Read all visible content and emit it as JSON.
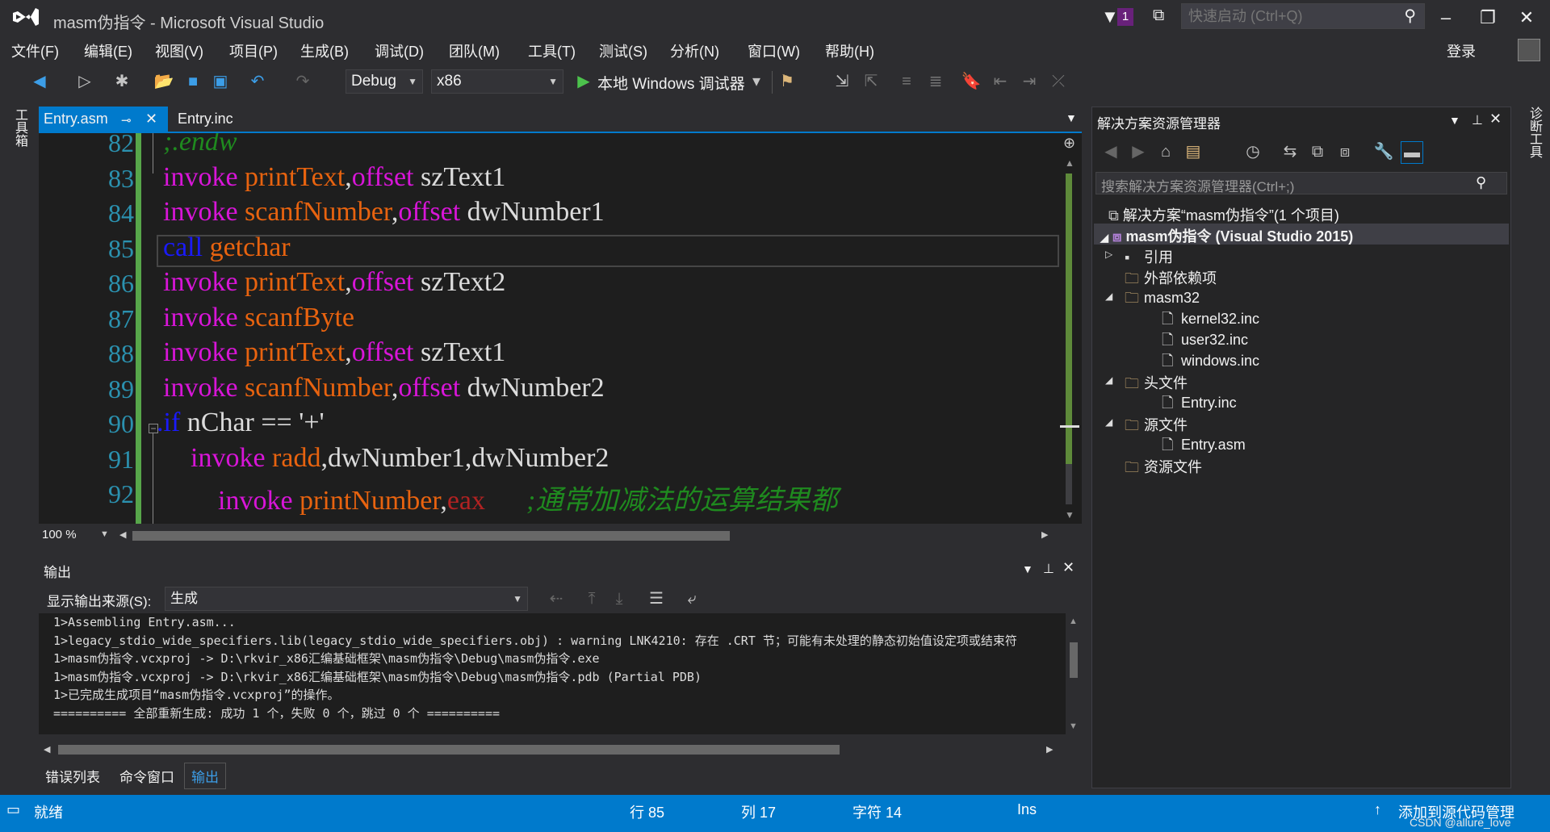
{
  "window": {
    "title": "masm伪指令 - Microsoft Visual Studio",
    "notification_count": "1",
    "quick_launch_placeholder": "快速启动 (Ctrl+Q)",
    "login_label": "登录"
  },
  "menu": [
    "文件(F)",
    "编辑(E)",
    "视图(V)",
    "项目(P)",
    "生成(B)",
    "调试(D)",
    "团队(M)",
    "工具(T)",
    "测试(S)",
    "分析(N)",
    "窗口(W)",
    "帮助(H)"
  ],
  "toolbar": {
    "config": "Debug",
    "platform": "x86",
    "debugger_label": "本地 Windows 调试器"
  },
  "left_strip_label": "工具箱",
  "right_strip_label": "诊断工具",
  "tabs": {
    "active": "Entry.asm",
    "inactive": "Entry.inc"
  },
  "editor": {
    "zoom": "100 %",
    "lines": [
      {
        "no": "82",
        "segs": [
          {
            "t": ";.endw",
            "c": "kw-green"
          }
        ]
      },
      {
        "no": "83",
        "segs": [
          {
            "t": "invoke ",
            "c": "kw-pink"
          },
          {
            "t": "printText",
            "c": "kw-orange"
          },
          {
            "t": ",",
            "c": ""
          },
          {
            "t": "offset ",
            "c": "kw-pink"
          },
          {
            "t": "szText1",
            "c": ""
          }
        ]
      },
      {
        "no": "84",
        "segs": [
          {
            "t": "invoke ",
            "c": "kw-pink"
          },
          {
            "t": "scanfNumber",
            "c": "kw-orange"
          },
          {
            "t": ",",
            "c": ""
          },
          {
            "t": "offset ",
            "c": "kw-pink"
          },
          {
            "t": "dwNumber1",
            "c": ""
          }
        ]
      },
      {
        "no": "85",
        "segs": [
          {
            "t": "call ",
            "c": "kw-blue"
          },
          {
            "t": "getchar",
            "c": "kw-orange"
          }
        ]
      },
      {
        "no": "86",
        "segs": [
          {
            "t": "invoke ",
            "c": "kw-pink"
          },
          {
            "t": "printText",
            "c": "kw-orange"
          },
          {
            "t": ",",
            "c": ""
          },
          {
            "t": "offset ",
            "c": "kw-pink"
          },
          {
            "t": "szText2",
            "c": ""
          }
        ]
      },
      {
        "no": "87",
        "segs": [
          {
            "t": "invoke ",
            "c": "kw-pink"
          },
          {
            "t": "scanfByte",
            "c": "kw-orange"
          }
        ]
      },
      {
        "no": "88",
        "segs": [
          {
            "t": "invoke ",
            "c": "kw-pink"
          },
          {
            "t": "printText",
            "c": "kw-orange"
          },
          {
            "t": ",",
            "c": ""
          },
          {
            "t": "offset ",
            "c": "kw-pink"
          },
          {
            "t": "szText1",
            "c": ""
          }
        ]
      },
      {
        "no": "89",
        "segs": [
          {
            "t": "invoke ",
            "c": "kw-pink"
          },
          {
            "t": "scanfNumber",
            "c": "kw-orange"
          },
          {
            "t": ",",
            "c": ""
          },
          {
            "t": "offset ",
            "c": "kw-pink"
          },
          {
            "t": "dwNumber2",
            "c": ""
          }
        ]
      },
      {
        "no": "90",
        "segs": [
          {
            "t": ".if ",
            "c": "kw-blue"
          },
          {
            "t": "nChar == '+'",
            "c": ""
          }
        ]
      },
      {
        "no": "91",
        "segs": [
          {
            "t": "    invoke ",
            "c": "kw-pink"
          },
          {
            "t": "radd",
            "c": "kw-orange"
          },
          {
            "t": ",dwNumber1,dwNumber2",
            "c": ""
          }
        ]
      },
      {
        "no": "92",
        "segs": [
          {
            "t": "        invoke ",
            "c": "kw-pink"
          },
          {
            "t": "printNumber",
            "c": "kw-orange"
          },
          {
            "t": ",",
            "c": ""
          },
          {
            "t": "eax",
            "c": "kw-red"
          },
          {
            "t": "      ;通常加减法的运算结果都",
            "c": "kw-green"
          }
        ]
      }
    ]
  },
  "output": {
    "title": "输出",
    "source_label": "显示输出来源(S):",
    "source_value": "生成",
    "lines": [
      "1>Assembling Entry.asm...",
      "1>legacy_stdio_wide_specifiers.lib(legacy_stdio_wide_specifiers.obj) : warning LNK4210: 存在 .CRT 节；可能有未处理的静态初始值设定项或结束符",
      "1>masm伪指令.vcxproj -> D:\\rkvir_x86汇编基础框架\\masm伪指令\\Debug\\masm伪指令.exe",
      "1>masm伪指令.vcxproj -> D:\\rkvir_x86汇编基础框架\\masm伪指令\\Debug\\masm伪指令.pdb (Partial PDB)",
      "1>已完成生成项目“masm伪指令.vcxproj”的操作。",
      "========== 全部重新生成: 成功 1 个，失败 0 个，跳过 0 个 =========="
    ]
  },
  "bottom_tabs": [
    "错误列表",
    "命令窗口",
    "输出"
  ],
  "solution_explorer": {
    "title": "解决方案资源管理器",
    "search_placeholder": "搜索解决方案资源管理器(Ctrl+;)",
    "solution": "解决方案“masm伪指令”(1 个项目)",
    "project": "masm伪指令 (Visual Studio 2015)",
    "items": [
      {
        "label": "引用",
        "indent": 1,
        "icon": "references-icon"
      },
      {
        "label": "外部依赖项",
        "indent": 1,
        "icon": "folder-icon"
      },
      {
        "label": "masm32",
        "indent": 1,
        "icon": "folder-icon"
      },
      {
        "label": "kernel32.inc",
        "indent": 2,
        "icon": "file-icon"
      },
      {
        "label": "user32.inc",
        "indent": 2,
        "icon": "file-icon"
      },
      {
        "label": "windows.inc",
        "indent": 2,
        "icon": "file-icon"
      },
      {
        "label": "头文件",
        "indent": 1,
        "icon": "folder-icon"
      },
      {
        "label": "Entry.inc",
        "indent": 2,
        "icon": "file-icon"
      },
      {
        "label": "源文件",
        "indent": 1,
        "icon": "folder-icon"
      },
      {
        "label": "Entry.asm",
        "indent": 2,
        "icon": "file-icon"
      },
      {
        "label": "资源文件",
        "indent": 1,
        "icon": "folder-icon"
      }
    ]
  },
  "status_bar": {
    "ready": "就绪",
    "line": "行 85",
    "col": "列 17",
    "char": "字符 14",
    "mode": "Ins",
    "source_control": "添加到源代码管理",
    "watermark": "CSDN @allure_love"
  },
  "colors": {
    "accent": "#007acc",
    "background": "#2d2d30",
    "editor_bg": "#1e1e1e"
  }
}
